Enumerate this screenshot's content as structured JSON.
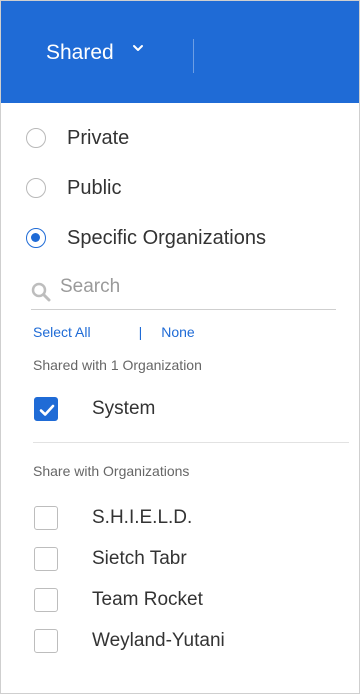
{
  "header": {
    "title": "Shared"
  },
  "visibility": {
    "options": [
      {
        "label": "Private",
        "checked": false
      },
      {
        "label": "Public",
        "checked": false
      },
      {
        "label": "Specific Organizations",
        "checked": true
      }
    ]
  },
  "search": {
    "placeholder": "Search"
  },
  "bulk": {
    "select_all": "Select All",
    "separator": "|",
    "none": "None"
  },
  "shared_section": {
    "label": "Shared with 1 Organization",
    "items": [
      {
        "label": "System",
        "checked": true
      }
    ]
  },
  "share_section": {
    "label": "Share with Organizations",
    "items": [
      {
        "label": "S.H.I.E.L.D.",
        "checked": false
      },
      {
        "label": "Sietch Tabr",
        "checked": false
      },
      {
        "label": "Team Rocket",
        "checked": false
      },
      {
        "label": "Weyland-Yutani",
        "checked": false
      }
    ]
  },
  "colors": {
    "accent": "#1f6bd6",
    "header_bg": "#1f6bd6"
  }
}
